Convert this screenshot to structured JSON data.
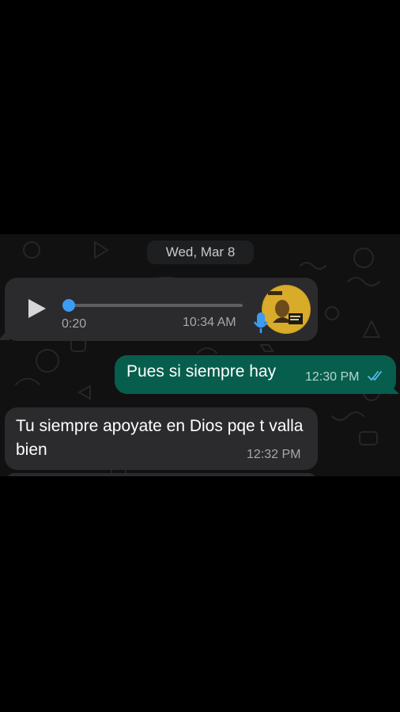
{
  "chat": {
    "date_chip": "Wed, Mar 8",
    "voice_message": {
      "duration": "0:20",
      "time": "10:34 AM",
      "progress": 0.02,
      "play_icon": "play-icon",
      "mic_icon": "microphone-icon",
      "accent_color": "#3c9cf2"
    },
    "outgoing_message": {
      "text": "Pues si siempre hay",
      "time": "12:30 PM",
      "status_icon": "double-check-icon",
      "bubble_color": "#075e4d"
    },
    "incoming_message": {
      "text": "Tu siempre apoyate en Dios pqe t valla bien",
      "time": "12:32 PM",
      "bubble_color": "#2b2b2d"
    }
  }
}
